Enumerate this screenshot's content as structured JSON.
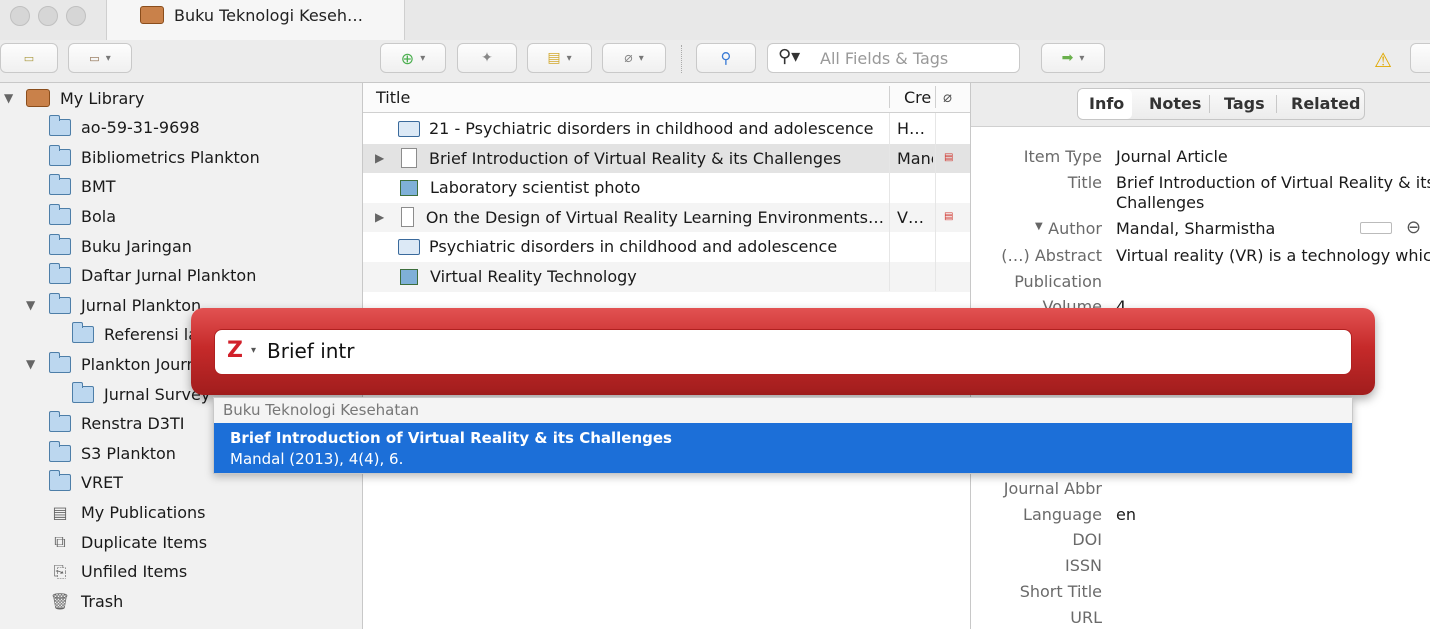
{
  "window": {
    "tab_title": "Buku Teknologi Keseh…"
  },
  "toolbar": {
    "search_placeholder": "All Fields & Tags"
  },
  "library": {
    "root": "My Library",
    "items": [
      {
        "label": "ao-59-31-9698",
        "type": "folder"
      },
      {
        "label": "Bibliometrics Plankton",
        "type": "folder"
      },
      {
        "label": "BMT",
        "type": "folder"
      },
      {
        "label": "Bola",
        "type": "folder"
      },
      {
        "label": "Buku Jaringan",
        "type": "folder"
      },
      {
        "label": "Daftar Jurnal Plankton",
        "type": "folder"
      },
      {
        "label": "Jurnal Plankton",
        "type": "folder"
      },
      {
        "label": "Referensi la",
        "type": "folder"
      },
      {
        "label": "Plankton Journ",
        "type": "folder"
      },
      {
        "label": "Jurnal Survey",
        "type": "folder"
      },
      {
        "label": "Renstra D3TI",
        "type": "folder"
      },
      {
        "label": "S3 Plankton",
        "type": "folder"
      },
      {
        "label": "VRET",
        "type": "folder"
      },
      {
        "label": "My Publications",
        "type": "publications"
      },
      {
        "label": "Duplicate Items",
        "type": "duplicates"
      },
      {
        "label": "Unfiled Items",
        "type": "unfiled"
      },
      {
        "label": "Trash",
        "type": "trash"
      }
    ]
  },
  "items": {
    "columns": {
      "title": "Title",
      "creator": "Cre"
    },
    "rows": [
      {
        "title": "21 - Psychiatric disorders in childhood and adolescence",
        "creator": "H…",
        "icon": "book-icon"
      },
      {
        "title": "Brief Introduction of Virtual Reality & its Challenges",
        "creator": "Manc",
        "icon": "document-icon"
      },
      {
        "title": "Laboratory scientist photo",
        "creator": "",
        "icon": "image-icon"
      },
      {
        "title": "On the Design of Virtual Reality Learning Environments…",
        "creator": "V…",
        "icon": "document-icon"
      },
      {
        "title": "Psychiatric disorders in childhood and adolescence",
        "creator": "",
        "icon": "book-icon"
      },
      {
        "title": "Virtual Reality Technology",
        "creator": "",
        "icon": "image-icon"
      }
    ]
  },
  "info": {
    "tabs": [
      "Info",
      "Notes",
      "Tags",
      "Related"
    ],
    "active_tab": "Info",
    "fields": {
      "item_type_label": "Item Type",
      "item_type": "Journal Article",
      "title_label": "Title",
      "title_line1": "Brief Introduction of Virtual Reality & its",
      "title_line2": "Challenges",
      "author_label": "Author",
      "author": "Mandal, Sharmistha",
      "abstract_label": "(…) Abstract",
      "abstract": "Virtual reality (VR) is a technology which",
      "publication_label": "Publication",
      "volume_label": "Volume",
      "volume": "4",
      "journal_abbr_label": "Journal Abbr",
      "language_label": "Language",
      "language": "en",
      "doi_label": "DOI",
      "issn_label": "ISSN",
      "short_title_label": "Short Title",
      "url_label": "URL"
    }
  },
  "quick_format": {
    "query": "Brief intr",
    "group": "Buku Teknologi Kesehatan",
    "result_title": "Brief Introduction of Virtual Reality & its Challenges",
    "result_citation": "Mandal (2013), 4(4), 6.",
    "accent": "#c62a2a",
    "selection_color": "#1c6fd8"
  }
}
